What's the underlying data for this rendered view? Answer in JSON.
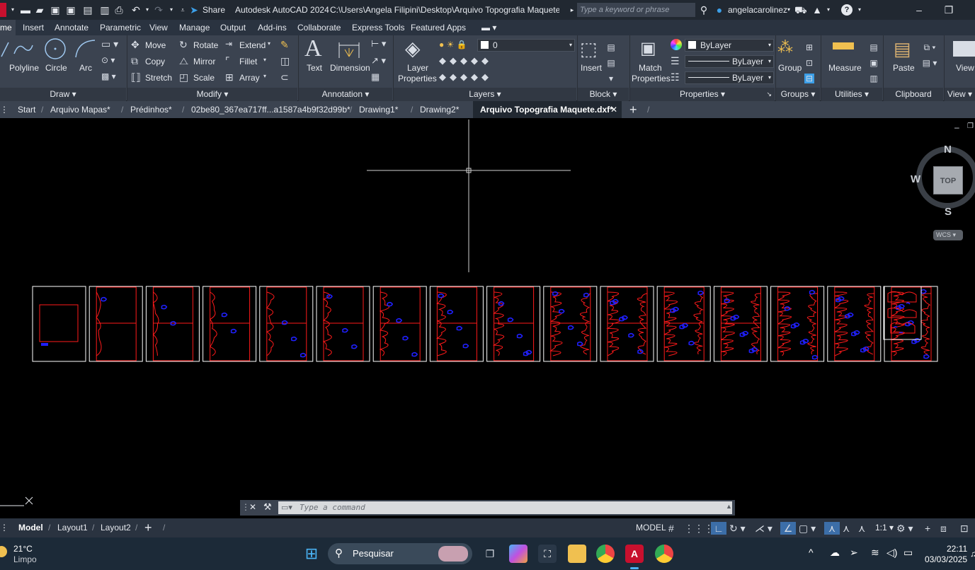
{
  "titlebar": {
    "share_label": "Share",
    "title": "Autodesk AutoCAD 2024",
    "path": "C:\\Users\\Angela Filipini\\Desktop\\Arquivo Topografia Maquete.dxf",
    "search_placeholder": "Type a keyword or phrase",
    "username": "angelacarolinez"
  },
  "ribbon_tabs": [
    "me",
    "Insert",
    "Annotate",
    "Parametric",
    "View",
    "Manage",
    "Output",
    "Add-ins",
    "Collaborate",
    "Express Tools",
    "Featured Apps"
  ],
  "ribbon": {
    "draw": {
      "title": "Draw",
      "polyline": "Polyline",
      "circle": "Circle",
      "arc": "Arc"
    },
    "modify": {
      "title": "Modify",
      "move": "Move",
      "rotate": "Rotate",
      "extend": "Extend",
      "copy": "Copy",
      "mirror": "Mirror",
      "fillet": "Fillet",
      "stretch": "Stretch",
      "scale": "Scale",
      "array": "Array"
    },
    "annotation": {
      "title": "Annotation",
      "text": "Text",
      "dimension": "Dimension"
    },
    "layers": {
      "title": "Layers",
      "layer_properties_1": "Layer",
      "layer_properties_2": "Properties",
      "current_layer": "0"
    },
    "block": {
      "title": "Block",
      "insert": "Insert"
    },
    "properties": {
      "title": "Properties",
      "match_1": "Match",
      "match_2": "Properties",
      "color": "ByLayer",
      "linetype": "ByLayer",
      "lineweight": "ByLayer"
    },
    "groups": {
      "title": "Groups",
      "group": "Group"
    },
    "utilities": {
      "title": "Utilities",
      "measure": "Measure"
    },
    "clipboard": {
      "title": "Clipboard",
      "paste": "Paste"
    },
    "view": {
      "title": "View"
    }
  },
  "file_tabs": [
    "Start",
    "Arquivo Mapas*",
    "Prédinhos*",
    "02be80_367ea717ff...a1587a4b9f32d99b*",
    "Drawing1*",
    "Drawing2*",
    "Arquivo Topografia Maquete.dxf*"
  ],
  "viewcube": {
    "north": "N",
    "south": "S",
    "west": "W",
    "face": "TOP",
    "wcs": "WCS"
  },
  "command": {
    "placeholder": "Type a command"
  },
  "layout_tabs": [
    "Model",
    "Layout1",
    "Layout2"
  ],
  "status": {
    "model": "MODEL",
    "scale": "1:1"
  },
  "taskbar": {
    "temp": "21°C",
    "weather": "Limpo",
    "search": "Pesquisar",
    "time": "22:11",
    "date": "03/03/2025"
  },
  "colors": {
    "ribbon_bg": "#3b4350",
    "title_bg": "#212831",
    "canvas_bg": "#000000",
    "frame_white": "#ffffff",
    "contour_red": "#ff1a1a",
    "contour_blue": "#2020ff",
    "accent": "#3c9fe8"
  }
}
